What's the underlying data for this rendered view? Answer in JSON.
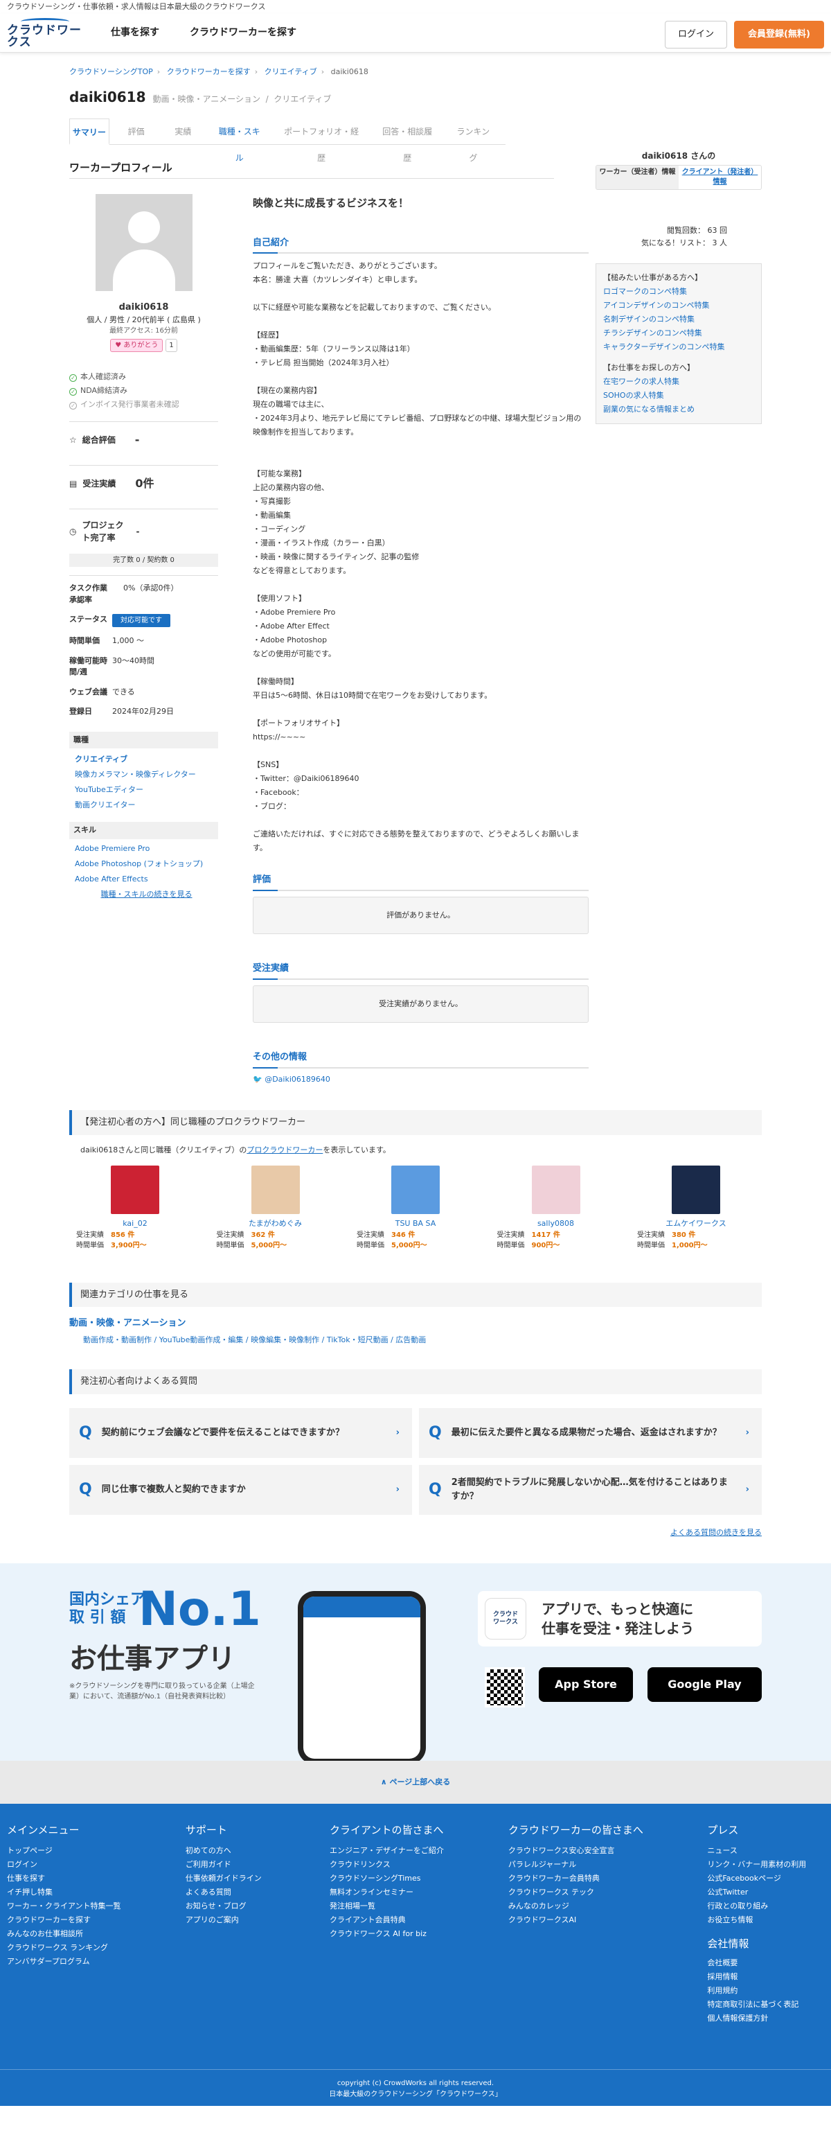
{
  "topbar": "クラウドソーシング・仕事依頼・求人情報は日本最大級のクラウドワークス",
  "header": {
    "logo": "クラウドワークス",
    "nav": [
      "仕事を探す",
      "クラウドワーカーを探す"
    ],
    "login": "ログイン",
    "register": "会員登録(無料)"
  },
  "breadcrumb": [
    "クラウドソーシングTOP",
    "クラウドワーカーを探す",
    "クリエイティブ",
    "daiki0618"
  ],
  "user": {
    "name": "daiki0618",
    "category": "動画・映像・アニメーション",
    "subcategory": "クリエイティブ"
  },
  "tabs": [
    "サマリー",
    "評価",
    "実績",
    "職種・スキル",
    "ポートフォリオ・経歴",
    "回答・相談履歴",
    "ランキング"
  ],
  "side": {
    "title": "daiki0618 さんの",
    "tab_worker": "ワーカー（受注者）情報",
    "tab_client": "クライアント（発注者）情報",
    "views_label": "閲覧回数：",
    "views": "63 回",
    "likes_label": "気になる！リスト：",
    "likes": "3 人",
    "interest": [
      "【槌みたい仕事がある方へ】",
      "ロゴマークのコンペ特集",
      "アイコンデザインのコンペ特集",
      "名刺デザインのコンペ特集",
      "チラシデザインのコンペ特集",
      "キャラクターデザインのコンペ特集",
      "",
      "【お仕事をお探しの方へ】",
      "在宅ワークの求人特集",
      "SOHOの求人特集",
      "副業の気になる情報まとめ"
    ]
  },
  "profile": {
    "title": "ワーカープロフィール",
    "name": "daiki0618",
    "info": "個人 / 男性 / 20代前半 ( 広島県 )",
    "access": "最終アクセス: 16分前",
    "thanks": "ありがとう",
    "thanks_count": "1",
    "checks": [
      "本人確認済み",
      "NDA締結済み",
      "インボイス発行事業者未確認"
    ],
    "rating_label": "総合評価",
    "rating": "-",
    "orders_label": "受注実績",
    "orders": "0件",
    "complete_label": "プロジェクト完了率",
    "complete": "-",
    "complete_sub": "完了数 0 / 契約数 0",
    "task_label": "タスク作業承認率",
    "task": "0%（承認0件）",
    "status_label": "ステータス",
    "status": "対応可能です",
    "rate_label": "時間単価",
    "rate": "1,000 〜",
    "hours_label": "稼働可能時間/週",
    "hours": "30〜40時間",
    "web_label": "ウェブ会議",
    "web": "できる",
    "reg_label": "登録日",
    "reg": "2024年02月29日",
    "job_head": "職種",
    "job_cat": "クリエイティブ",
    "jobs": [
      "映像カメラマン・映像ディレクター",
      "YouTubeエディター",
      "動画クリエイター"
    ],
    "skill_head": "スキル",
    "skills": [
      "Adobe Premiere Pro",
      "Adobe Photoshop (フォトショップ)",
      "Adobe After Effects"
    ],
    "more": "職種・スキルの続きを見る"
  },
  "catch": "映像と共に成長するビジネスを！",
  "intro_title": "自己紹介",
  "intro": "プロフィールをご覧いただき、ありがとうございます。\n本名：勝達 大喜（カツレンダイキ）と申します。\n\n以下に経歴や可能な業務などを記載しておりますので、ご覧ください。\n\n【経歴】\n・動画編集歴：5年（フリーランス以降は1年）\n・テレビ局 担当開始（2024年3月入社）\n\n【現在の業務内容】\n現在の職場では主に、\n・2024年3月より、地元テレビ局にてテレビ番組、プロ野球などの中継、球場大型ビジョン用の映像制作を担当しております。\n\n\n【可能な業務】\n上記の業務内容の他、\n・写真撮影\n・動画編集\n・コーディング\n・漫画・イラスト作成（カラー・白黒）\n・映画・映像に関するライティング、記事の監修\nなどを得意としております。\n\n【使用ソフト】\n・Adobe Premiere Pro\n・Adobe After Effect\n・Adobe Photoshop\nなどの使用が可能です。\n\n【稼働時間】\n平日は5～6時間、休日は10時間で在宅ワークをお受けしております。\n\n【ポートフォリオサイト】\nhttps://~~~~\n\n【SNS】\n・Twitter：@Daiki06189640\n・Facebook：\n・ブログ：\n\nご連絡いただければ、すぐに対応できる態勢を整えておりますので、どうぞよろしくお願いします。",
  "eval_title": "評価",
  "eval_empty": "評価がありません。",
  "orders_title": "受注実績",
  "orders_empty": "受注実績がありません。",
  "other_title": "その他の情報",
  "twitter": "@Daiki06189640",
  "similar": {
    "title": "【発注初心者の方へ】同じ職種のプロクラウドワーカー",
    "desc_pre": "daiki0618さんと同じ職種（クリエイティブ）の",
    "desc_link": "プロクラウドワーカー",
    "desc_post": "を表示しています。",
    "workers": [
      {
        "name": "kai_02",
        "orders": "856 件",
        "rate": "3,900円〜",
        "color": "#c23"
      },
      {
        "name": "たまがわめぐみ",
        "orders": "362 件",
        "rate": "5,000円〜",
        "color": "#e8c9a8"
      },
      {
        "name": "TSU BA SA",
        "orders": "346 件",
        "rate": "5,000円〜",
        "color": "#5b9be0"
      },
      {
        "name": "sally0808",
        "orders": "1417 件",
        "rate": "900円〜",
        "color": "#f0d0d8"
      },
      {
        "name": "エムケイワークス",
        "orders": "380 件",
        "rate": "1,000円〜",
        "color": "#1a2a4a"
      }
    ],
    "orders_label": "受注実績",
    "rate_label": "時間単価"
  },
  "related": {
    "title": "関連カテゴリの仕事を見る",
    "cat": "動画・映像・アニメーション",
    "links": "動画作成・動画制作 / YouTube動画作成・編集 / 映像編集・映像制作 / TikTok・短尺動画 / 広告動画"
  },
  "faq": {
    "title": "発注初心者向けよくある質問",
    "items": [
      "契約前にウェブ会議などで要件を伝えることはできますか？",
      "最初に伝えた要件と異なる成果物だった場合、返金はされますか？",
      "同じ仕事で複数人と契約できますか",
      "2者間契約でトラブルに発展しないか心配…気を付けることはありますか？"
    ],
    "more": "よくある質問の続きを見る"
  },
  "promo": {
    "l1": "国内シェア\n取 引 額",
    "no1": "No.1",
    "app": "お仕事アプリ",
    "note": "※クラウドソーシングを専門に取り扱っている企業（上場企業）において、流通額がNo.1（自社発表資料比較）",
    "bubble": "アプリで、もっと快適に\n仕事を受注・発注しよう",
    "appstore": "App Store",
    "googleplay": "Google Play"
  },
  "totop": "∧ ページ上部へ戻る",
  "footer": {
    "cols": [
      {
        "h": "メインメニュー",
        "items": [
          "トップページ",
          "ログイン",
          "仕事を探す",
          "イチ押し特集",
          "ワーカー・クライアント特集一覧",
          "クラウドワーカーを探す",
          "みんなのお仕事相談所",
          "クラウドワークス ランキング",
          "アンバサダープログラム"
        ]
      },
      {
        "h": "サポート",
        "items": [
          "初めての方へ",
          "ご利用ガイド",
          "仕事依頼ガイドライン",
          "よくある質問",
          "お知らせ・ブログ",
          "アプリのご案内"
        ]
      },
      {
        "h": "クライアントの皆さまへ",
        "items": [
          "エンジニア・デザイナーをご紹介",
          "クラウドリンクス",
          "クラウドソーシングTimes",
          "無料オンラインセミナー",
          "発注相場一覧",
          "クライアント会員特典",
          "クラウドワークス AI for biz"
        ]
      },
      {
        "h": "クラウドワーカーの皆さまへ",
        "items": [
          "クラウドワークス安心安全宣言",
          "パラレルジャーナル",
          "クラウドワーカー会員特典",
          "クラウドワークス テック",
          "みんなのカレッジ",
          "クラウドワークスAI"
        ]
      },
      {
        "h": "プレス",
        "items": [
          "ニュース",
          "リンク・バナー用素材の利用",
          "公式Facebookページ",
          "公式Twitter",
          "行政との取り組み",
          "お役立ち情報",
          "",
          "会社情報",
          "会社概要",
          "採用情報",
          "利用規約",
          "特定商取引法に基づく表記",
          "個人情報保護方針"
        ]
      }
    ],
    "copy": "copyright (c) CrowdWorks all rights reserved.",
    "tag": "日本最大級のクラウドソーシング「クラウドワークス」"
  }
}
